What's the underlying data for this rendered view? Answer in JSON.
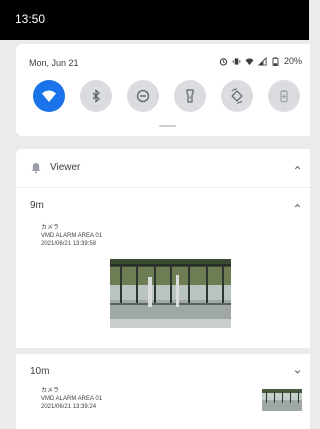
{
  "status_bar": {
    "time": "13:50"
  },
  "quick_settings": {
    "date": "Mon, Jun 21",
    "battery": "20%",
    "tiles": [
      {
        "icon": "wifi-icon",
        "active": true
      },
      {
        "icon": "bluetooth-icon",
        "active": false
      },
      {
        "icon": "do-not-disturb-icon",
        "active": false
      },
      {
        "icon": "flashlight-icon",
        "active": false
      },
      {
        "icon": "auto-rotate-icon",
        "active": false
      },
      {
        "icon": "battery-saver-icon",
        "active": false
      }
    ]
  },
  "notification_group": {
    "app_name": "Viewer",
    "notifications": [
      {
        "age": "9m",
        "camera": "カメラ",
        "event": "VMD ALARM AREA 01",
        "timestamp": "2021/06/21 13:39:58",
        "expanded": true
      },
      {
        "age": "10m",
        "camera": "カメラ",
        "event": "VMD ALARM AREA 01",
        "timestamp": "2021/06/21 13:39:24",
        "expanded": false
      }
    ]
  },
  "colors": {
    "accent": "#1a73e8",
    "status_bar": "#000000",
    "tile_inactive": "#dadce0"
  }
}
